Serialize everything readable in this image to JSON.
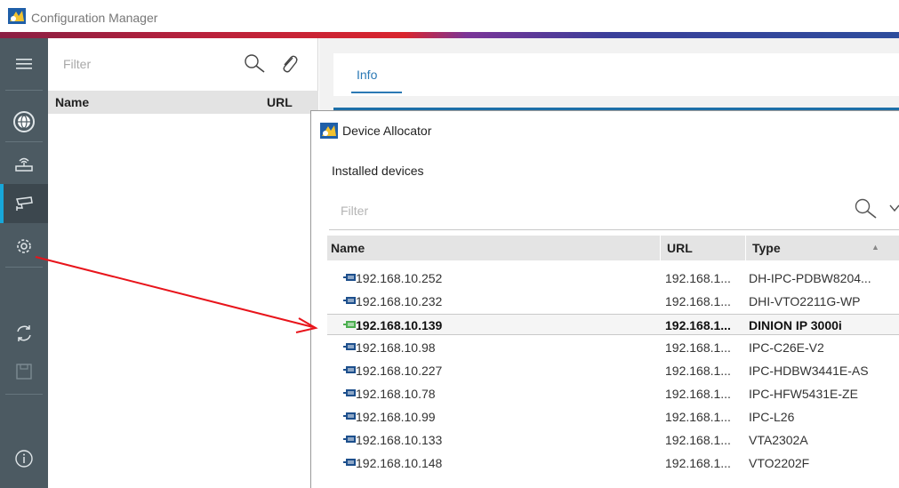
{
  "app": {
    "title": "Configuration Manager"
  },
  "device_panel": {
    "filter_placeholder": "Filter",
    "columns": {
      "name": "Name",
      "url": "URL"
    }
  },
  "main": {
    "tabs": [
      {
        "label": "Info",
        "active": true
      }
    ]
  },
  "dialog": {
    "title": "Device Allocator",
    "section_label": "Installed devices",
    "filter_placeholder": "Filter",
    "columns": {
      "name": "Name",
      "url": "URL",
      "type": "Type"
    },
    "selected_index": 2,
    "rows": [
      {
        "name": "192.168.10.252",
        "url": "192.168.1...",
        "type": "DH-IPC-PDBW8204..."
      },
      {
        "name": "192.168.10.232",
        "url": "192.168.1...",
        "type": "DHI-VTO2211G-WP"
      },
      {
        "name": "192.168.10.139",
        "url": "192.168.1...",
        "type": "DINION IP 3000i"
      },
      {
        "name": "192.168.10.98",
        "url": "192.168.1...",
        "type": "IPC-C26E-V2"
      },
      {
        "name": "192.168.10.227",
        "url": "192.168.1...",
        "type": "IPC-HDBW3441E-AS"
      },
      {
        "name": "192.168.10.78",
        "url": "192.168.1...",
        "type": "IPC-HFW5431E-ZE"
      },
      {
        "name": "192.168.10.99",
        "url": "192.168.1...",
        "type": "IPC-L26"
      },
      {
        "name": "192.168.10.133",
        "url": "192.168.1...",
        "type": "VTA2302A"
      },
      {
        "name": "192.168.10.148",
        "url": "192.168.1...",
        "type": "VTO2202F"
      }
    ]
  },
  "colors": {
    "nav_bg": "#4c5a62",
    "accent_blue": "#2b79b5",
    "nav_active_marker": "#17a7d9",
    "annotation_red": "#e8141b",
    "device_icon_green": "#4caf50",
    "device_icon_blue": "#1d4f8c"
  },
  "icons": {
    "nav": [
      "menu-icon",
      "network-globe-icon",
      "router-icon",
      "camera-icon",
      "gear-icon",
      "refresh-icon",
      "save-icon",
      "info-icon"
    ],
    "toolbar": [
      "search-icon",
      "paperclip-icon"
    ]
  }
}
